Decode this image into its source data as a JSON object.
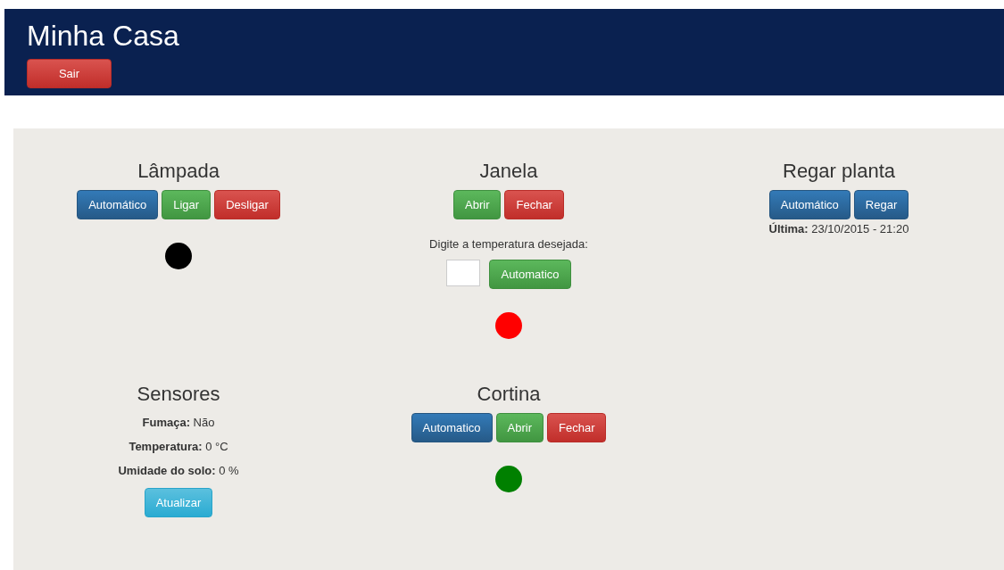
{
  "header": {
    "title": "Minha Casa",
    "logout_button": "Sair"
  },
  "sections": [
    {
      "title": "Lâmpada",
      "blocks": [
        {
          "kind": "buttons",
          "buttons": [
            {
              "label": "Automático",
              "kind": "primary"
            },
            {
              "label": "Ligar",
              "kind": "success"
            },
            {
              "label": "Desligar",
              "kind": "danger"
            }
          ]
        },
        {
          "kind": "status",
          "color": "#000000"
        }
      ]
    },
    {
      "title": "Janela",
      "blocks": [
        {
          "kind": "buttons",
          "buttons": [
            {
              "label": "Abrir",
              "kind": "success"
            },
            {
              "label": "Fechar",
              "kind": "danger"
            }
          ]
        },
        {
          "kind": "temperature",
          "prompt": "Digite a temperatura desejada:",
          "button": {
            "label": "Automatico",
            "kind": "success"
          }
        },
        {
          "kind": "status",
          "color": "#ff0000"
        }
      ]
    },
    {
      "title": "Regar planta",
      "blocks": [
        {
          "kind": "buttons",
          "buttons": [
            {
              "label": "Automático",
              "kind": "primary"
            },
            {
              "label": "Regar",
              "kind": "primary"
            }
          ]
        },
        {
          "kind": "lines",
          "lines": [
            "**Última:** 23/10/2015 - 21:20"
          ]
        }
      ]
    },
    {
      "title": "Sensores",
      "blocks": [
        {
          "kind": "lines",
          "lines": [
            "**Fumaça:** Não",
            "**Temperatura:** 0 °C",
            "**Umidade do solo:** 0 %"
          ]
        },
        {
          "kind": "buttons",
          "buttons": [
            {
              "label": "Atualizar",
              "kind": "info"
            }
          ]
        }
      ]
    },
    {
      "title": "Cortina",
      "blocks": [
        {
          "kind": "buttons",
          "buttons": [
            {
              "label": "Automatico",
              "kind": "primary"
            },
            {
              "label": "Abrir",
              "kind": "success"
            },
            {
              "label": "Fechar",
              "kind": "danger"
            }
          ]
        },
        {
          "kind": "status",
          "color": "#008000"
        }
      ]
    }
  ]
}
